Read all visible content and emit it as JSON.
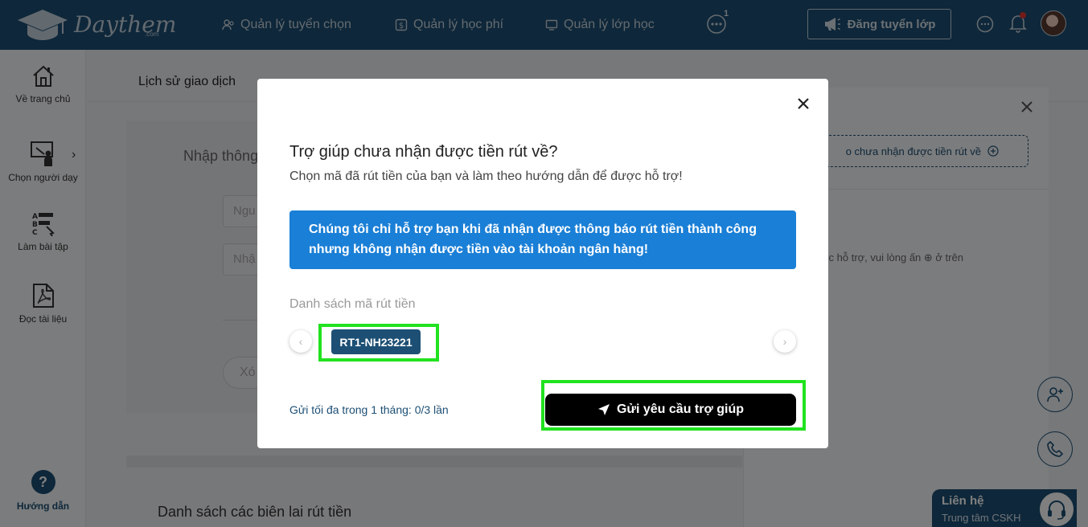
{
  "header": {
    "logo_text": "Daythem",
    "logo_suffix": ".com",
    "nav": [
      {
        "label": "Quản lý tuyển chọn",
        "icon": "users-icon"
      },
      {
        "label": "Quản lý học phí",
        "icon": "dollar-icon"
      },
      {
        "label": "Quản lý lớp học",
        "icon": "classroom-icon"
      }
    ],
    "more_badge": "1",
    "post_button": "Đăng tuyển lớp"
  },
  "sidebar": {
    "items": [
      {
        "label": "Về trang chủ",
        "icon": "home-icon"
      },
      {
        "label": "Chọn người dạy",
        "icon": "teacher-icon"
      },
      {
        "label": "Làm bài tập",
        "icon": "exercise-icon"
      },
      {
        "label": "Đọc tài liệu",
        "icon": "pdf-icon"
      }
    ],
    "help_symbol": "?",
    "help_label": "Hướng dẫn"
  },
  "page": {
    "tab_label": "Lịch sử giao dịch",
    "form_title": "Nhập thông",
    "input1_placeholder": "Ngu",
    "input2_placeholder": "Nhậ",
    "delete_button": "Xó",
    "receipts_title": "Danh sách các biên lai rút tiền"
  },
  "right_panel": {
    "dashed_text": "o chưa nhận được tiền rút về",
    "note_text": "ợc hỗ trợ, vui lòng ấn ⊕ ở trên"
  },
  "contact": {
    "title": "Liên hệ",
    "subtitle": "Trung tâm CSKH"
  },
  "modal": {
    "title": "Trợ giúp chưa nhận được tiền rút về?",
    "subtitle": "Chọn mã đã rút tiền của bạn và làm theo hướng dẫn để được hỗ trợ!",
    "info": "Chúng tôi chỉ hỗ trợ bạn khi đã nhận được thông báo rút tiền thành công nhưng không nhận được tiền vào tài khoản ngân hàng!",
    "list_label": "Danh sách mã rút tiền",
    "codes": [
      "RT1-NH23221"
    ],
    "limit_text": "Gửi tối đa trong 1 tháng: 0/3 lần",
    "send_button": "Gửi yêu cầu trợ giúp"
  },
  "colors": {
    "brand": "#1d4f74",
    "info": "#1a7fd6",
    "highlight": "#21e21f"
  }
}
